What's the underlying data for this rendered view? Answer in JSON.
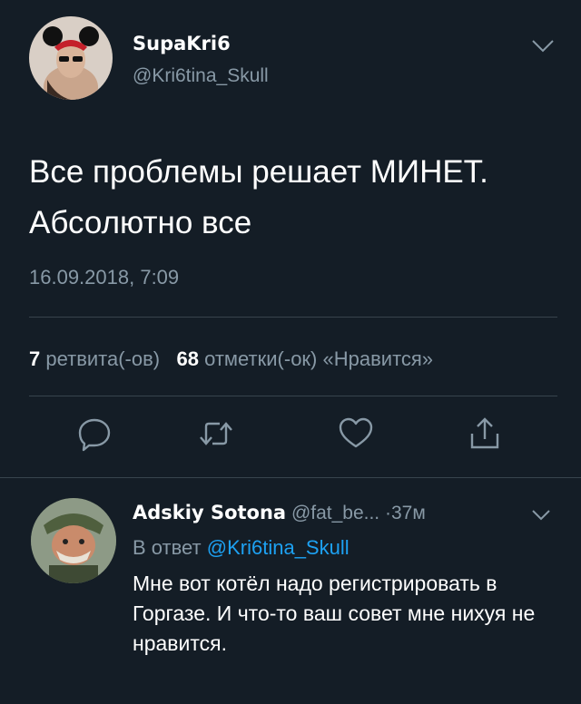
{
  "tweet": {
    "display_name": "SupaKri6",
    "handle": "@Kri6tina_Skull",
    "text": "Все проблемы решает МИНЕТ. Абсолютно все",
    "timestamp": "16.09.2018, 7:09",
    "retweets_count": "7",
    "retweets_label": "ретвита(-ов)",
    "likes_count": "68",
    "likes_label": "отметки(-ок) «Нравится»"
  },
  "reply": {
    "display_name": "Adskiy Sotona",
    "handle": "@fat_be...",
    "separator": "·",
    "time": "37м",
    "reply_prefix": "В ответ",
    "reply_mention": "@Kri6tina_Skull",
    "text": "Мне вот котёл надо регистрировать в Горгазе. И что-то ваш совет мне нихуя не нравится."
  },
  "colors": {
    "background": "#141d26",
    "secondary_text": "#8899a6",
    "link": "#1da1f2",
    "divider": "#38444d"
  },
  "icons": [
    "chevron-down-icon",
    "reply-icon",
    "retweet-icon",
    "heart-icon",
    "share-icon"
  ]
}
